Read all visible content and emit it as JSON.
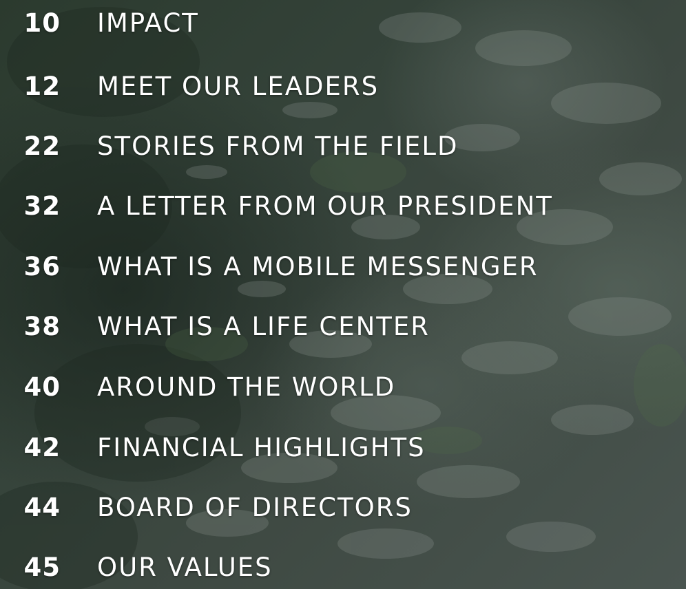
{
  "toc": {
    "entries": [
      {
        "page": "10",
        "title": "IMPACT"
      },
      {
        "page": "12",
        "title": "MEET OUR LEADERS"
      },
      {
        "page": "22",
        "title": "STORIES FROM THE FIELD"
      },
      {
        "page": "32",
        "title": "A LETTER FROM OUR PRESIDENT"
      },
      {
        "page": "36",
        "title": "WHAT IS A MOBILE MESSENGER"
      },
      {
        "page": "38",
        "title": "WHAT IS A LIFE CENTER"
      },
      {
        "page": "40",
        "title": "AROUND THE WORLD"
      },
      {
        "page": "42",
        "title": "FINANCIAL HIGHLIGHTS"
      },
      {
        "page": "44",
        "title": "BOARD OF DIRECTORS"
      },
      {
        "page": "45",
        "title": "OUR VALUES"
      }
    ]
  },
  "colors": {
    "text": "#ffffff",
    "background": "#2f3a33"
  }
}
